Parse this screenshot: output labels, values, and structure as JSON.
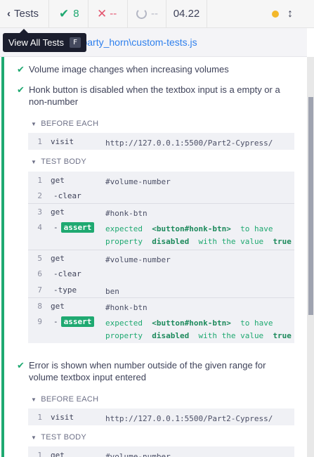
{
  "header": {
    "tests_label": "Tests",
    "passed_count": "8",
    "failed_count": "--",
    "pending_count": "--",
    "duration": "04.22",
    "colors": {
      "passed": "#1fa971",
      "failed": "#e45770",
      "pending": "#b4b7c4",
      "running_dot": "#f3b82b"
    }
  },
  "tooltip": {
    "text": "View All Tests",
    "shortcut": "F"
  },
  "filebar": {
    "path": "tion\\party_horn\\custom-tests.js"
  },
  "tests": [
    {
      "title": "Volume image changes when increasing volumes"
    },
    {
      "title": "Honk button is disabled when the textbox input is a empty or a non-number"
    },
    {
      "title": "Error is shown when number outside of the given range for volume textbox input entered"
    }
  ],
  "sections": {
    "before_each": "BEFORE EACH",
    "test_body": "TEST BODY"
  },
  "test2": {
    "before_each": [
      {
        "num": "1",
        "name": "visit",
        "message": "http://127.0.0.1:5500/Part2-Cypress/"
      }
    ],
    "body": [
      {
        "num": "1",
        "name": "get",
        "message": "#volume-number"
      },
      {
        "num": "2",
        "name": "-clear",
        "message": ""
      },
      {
        "num": "3",
        "name": "get",
        "message": "#honk-btn"
      },
      {
        "num": "4",
        "name": "assert",
        "msg_parts": [
          "expected",
          "<button#honk-btn>",
          "to have property",
          "disabled",
          "with the value",
          "true"
        ]
      },
      {
        "num": "5",
        "name": "get",
        "message": "#volume-number"
      },
      {
        "num": "6",
        "name": "-clear",
        "message": ""
      },
      {
        "num": "7",
        "name": "-type",
        "message": "ben"
      },
      {
        "num": "8",
        "name": "get",
        "message": "#honk-btn"
      },
      {
        "num": "9",
        "name": "assert",
        "msg_parts": [
          "expected",
          "<button#honk-btn>",
          "to have property",
          "disabled",
          "with the value",
          "true"
        ]
      }
    ]
  },
  "test3": {
    "before_each": [
      {
        "num": "1",
        "name": "visit",
        "message": "http://127.0.0.1:5500/Part2-Cypress/"
      }
    ],
    "body": [
      {
        "num": "1",
        "name": "get",
        "message": "#volume-number"
      }
    ]
  }
}
